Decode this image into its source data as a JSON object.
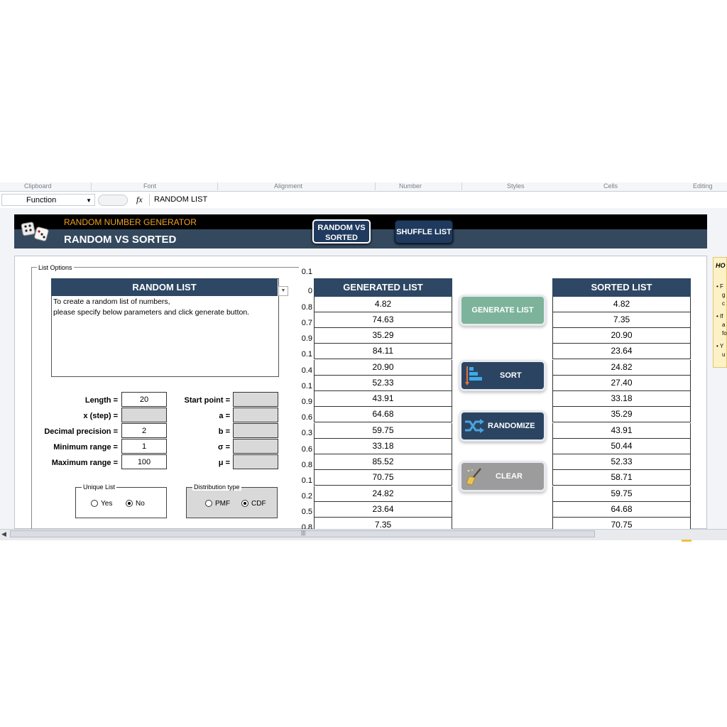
{
  "ribbon": {
    "groups": [
      "Clipboard",
      "Font",
      "Alignment",
      "Number",
      "Styles",
      "Cells",
      "Editing"
    ]
  },
  "formula_bar": {
    "name_box": "Function",
    "fx": "fx",
    "content": "RANDOM LIST"
  },
  "header": {
    "subtitle": "RANDOM NUMBER GENERATOR",
    "title": "RANDOM VS SORTED",
    "btn_random_vs_sorted_line1": "RANDOM VS",
    "btn_random_vs_sorted_line2": "SORTED",
    "btn_shuffle_list": "SHUFFLE LIST"
  },
  "list_options": {
    "label": "List Options",
    "random_list_title": "RANDOM LIST",
    "desc_line1": "To create a random list of numbers,",
    "desc_line2": "please specify below parameters and click generate button.",
    "params_left": [
      {
        "label": "Length =",
        "value": "20"
      },
      {
        "label": "x (step) =",
        "value": ""
      },
      {
        "label": "Decimal precision =",
        "value": "2"
      },
      {
        "label": "Minimum range =",
        "value": "1"
      },
      {
        "label": "Maximum range =",
        "value": "100"
      }
    ],
    "params_right": [
      {
        "label": "Start point =",
        "value": ""
      },
      {
        "label": "a =",
        "value": ""
      },
      {
        "label": "b =",
        "value": ""
      },
      {
        "label": "σ =",
        "value": ""
      },
      {
        "label": "μ =",
        "value": ""
      }
    ],
    "unique_list": {
      "title": "Unique List",
      "yes": "Yes",
      "no": "No",
      "selected": "No"
    },
    "distribution_type": {
      "title": "Distribution type",
      "pmf": "PMF",
      "cdf": "CDF",
      "selected": "CDF"
    }
  },
  "probabilities": [
    "0.1",
    "0",
    "0.8",
    "0.7",
    "0.9",
    "0.1",
    "0.4",
    "0.1",
    "0.9",
    "0.6",
    "0.3",
    "0.6",
    "0.8",
    "0.1",
    "0.2",
    "0.5",
    "0.8"
  ],
  "generated_list": {
    "title": "GENERATED LIST",
    "values": [
      "4.82",
      "74.63",
      "35.29",
      "84.11",
      "20.90",
      "52.33",
      "43.91",
      "64.68",
      "59.75",
      "33.18",
      "85.52",
      "70.75",
      "24.82",
      "23.64",
      "7.35"
    ]
  },
  "sorted_list": {
    "title": "SORTED LIST",
    "values": [
      "4.82",
      "7.35",
      "20.90",
      "23.64",
      "24.82",
      "27.40",
      "33.18",
      "35.29",
      "43.91",
      "50.44",
      "52.33",
      "58.71",
      "59.75",
      "64.68",
      "70.75"
    ]
  },
  "actions": {
    "generate": "GENERATE LIST",
    "sort": "SORT",
    "randomize": "RANDOMIZE",
    "clear": "CLEAR"
  },
  "how_panel": {
    "title": "HO",
    "bullet_letters": [
      "F",
      "g",
      "c",
      "If",
      "a",
      "fo",
      "Y",
      "u"
    ]
  },
  "colors": {
    "header_navy": "#34495e",
    "subtitle_orange": "#f0a020",
    "table_header": "#2e4764",
    "generate_green": "#7db39a",
    "clear_gray": "#9c9c9c"
  }
}
